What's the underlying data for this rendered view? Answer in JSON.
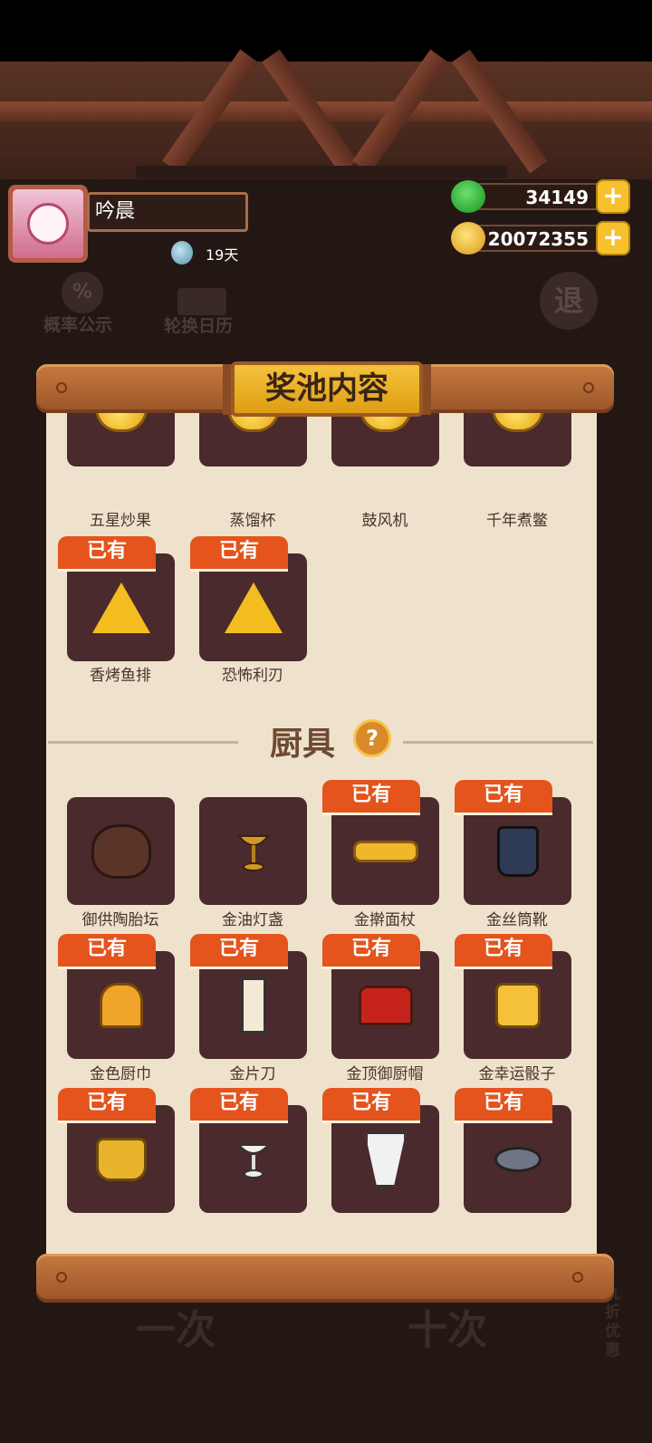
{
  "header": {
    "player_name": "吟晨",
    "days": "19天",
    "jade_value": "34149",
    "coin_value": "20072355",
    "plus_symbol": "+"
  },
  "background": {
    "probability": "概率公示",
    "calendar": "轮换日历",
    "exit": "退",
    "bottom_left": "一次",
    "bottom_right": "十次",
    "discount": "九折优惠"
  },
  "panel": {
    "title": "奖池内容",
    "owned_badge": "已有",
    "row_partial": [
      "五星炒果",
      "蒸馏杯",
      "鼓风机",
      "千年煮鳖"
    ],
    "row_owned": [
      "香烤鱼排",
      "恐怖利刃"
    ],
    "section_title": "厨具",
    "section_help": "?",
    "utensils_row1": [
      "御供陶胎坛",
      "金油灯盏",
      "金擀面杖",
      "金丝筒靴"
    ],
    "utensils_row2": [
      "金色厨巾",
      "金片刀",
      "金顶御厨帽",
      "金幸运骰子"
    ]
  },
  "colors": {
    "badge": "#e4541c",
    "card": "#4a2a2d",
    "paper": "#efe2cc",
    "title_gold": "#f0b52a"
  }
}
